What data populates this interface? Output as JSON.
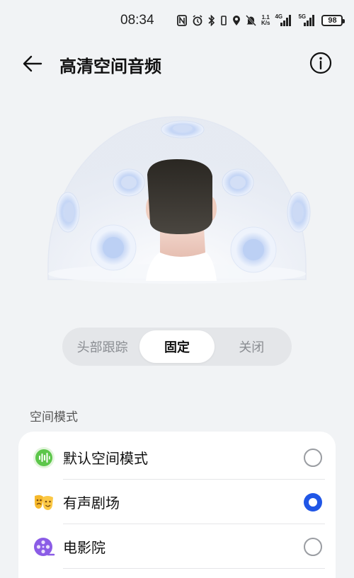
{
  "status_bar": {
    "time": "08:34",
    "net_speed_value": "1.1",
    "net_speed_unit": "K/s",
    "cell1_tag": "4G",
    "cell2_tag": "5G",
    "battery": "98",
    "icons": [
      "nfc-icon",
      "alarm-icon",
      "bluetooth-icon",
      "vibrate-icon",
      "location-icon",
      "mute-icon",
      "signal-icon",
      "battery-icon"
    ]
  },
  "header": {
    "title": "高清空间音频"
  },
  "segmented": {
    "options": [
      "头部跟踪",
      "固定",
      "关闭"
    ],
    "selected": "固定"
  },
  "section": {
    "label": "空间模式"
  },
  "modes": [
    {
      "label": "默认空间模式",
      "icon": "sound-wave-icon",
      "color": "#5cc64a",
      "checked": false
    },
    {
      "label": "有声剧场",
      "icon": "theater-mask-icon",
      "color": "#f6b92c",
      "checked": true
    },
    {
      "label": "电影院",
      "icon": "film-reel-icon",
      "color": "#8b5ce6",
      "checked": false
    }
  ],
  "colors": {
    "accent": "#2056e6",
    "background": "#f1f3f5"
  }
}
